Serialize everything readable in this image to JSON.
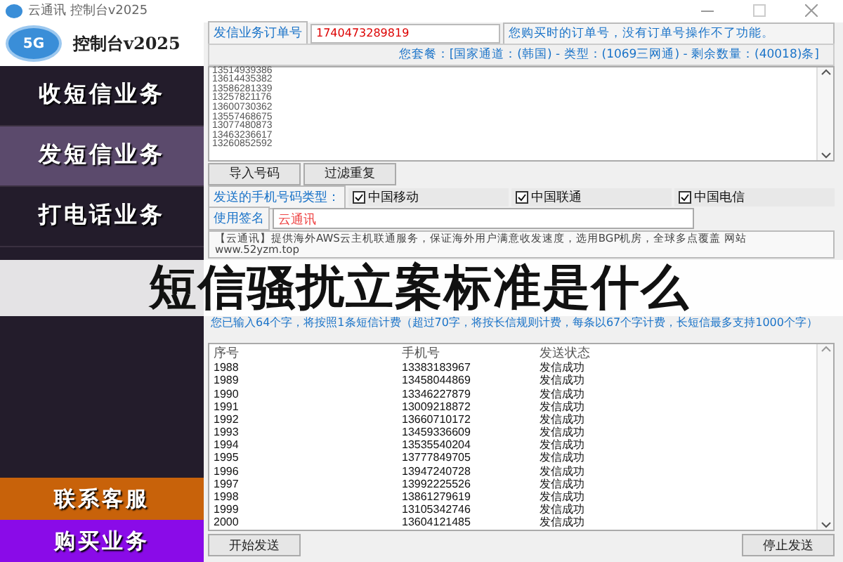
{
  "window": {
    "title": "云通讯 控制台v2025"
  },
  "logo": {
    "badge": "5G",
    "title": "控制台v2025"
  },
  "sidebar": {
    "items": [
      {
        "label": "收短信业务",
        "selected": false,
        "kind": "nav"
      },
      {
        "label": "发短信业务",
        "selected": true,
        "kind": "nav"
      },
      {
        "label": "打电话业务",
        "selected": false,
        "kind": "nav"
      }
    ],
    "footer": [
      {
        "label": "联系客服",
        "color": "#c8620a"
      },
      {
        "label": "购买业务",
        "color": "#8a0be8"
      }
    ]
  },
  "order": {
    "label": "发信业务订单号",
    "value": "1740473289819",
    "hint": "您购买时的订单号，没有订单号操作不了功能。"
  },
  "plan": "您套餐：[国家通道：(韩国) - 类型：(1069三网通) - 剩余数量：(40018)条]",
  "numbers": [
    "13514939386",
    "13614435382",
    "13586281339",
    "13257821176",
    "13600730362",
    "13557468675",
    "13077480873",
    "13463236617",
    "13260852592"
  ],
  "tools": [
    "导入号码",
    "过滤重复"
  ],
  "carriers": {
    "label": "发送的手机号码类型：",
    "items": [
      {
        "label": "中国移动",
        "checked": true
      },
      {
        "label": "中国联通",
        "checked": true
      },
      {
        "label": "中国电信",
        "checked": true
      }
    ]
  },
  "signature": {
    "label": "使用签名",
    "value": "云通讯"
  },
  "message": "【云通讯】提供海外AWS云主机联通服务，保证海外用户满意收发速度，选用BGP机房，全球多点覆盖 网站 www.52yzm.top",
  "count": "您已输入64个字，将按照1条短信计费（超过70字，将按长信规则计费，每条以67个字计费，长短信最多支持1000个字）",
  "table": {
    "columns": [
      "序号",
      "手机号",
      "发送状态"
    ],
    "rows": [
      [
        "1988",
        "13383183967",
        "发信成功"
      ],
      [
        "1989",
        "13458044869",
        "发信成功"
      ],
      [
        "1990",
        "13346227879",
        "发信成功"
      ],
      [
        "1991",
        "13009218872",
        "发信成功"
      ],
      [
        "1992",
        "13660710172",
        "发信成功"
      ],
      [
        "1993",
        "13459336609",
        "发信成功"
      ],
      [
        "1994",
        "13535540204",
        "发信成功"
      ],
      [
        "1995",
        "13777849705",
        "发信成功"
      ],
      [
        "1996",
        "13947240728",
        "发信成功"
      ],
      [
        "1997",
        "13992225526",
        "发信成功"
      ],
      [
        "1998",
        "13861279619",
        "发信成功"
      ],
      [
        "1999",
        "13105342746",
        "发信成功"
      ],
      [
        "2000",
        "13604121485",
        "发信成功"
      ]
    ]
  },
  "actions": [
    "开始发送",
    "停止发送"
  ],
  "banner": "短信骚扰立案标准是什么"
}
